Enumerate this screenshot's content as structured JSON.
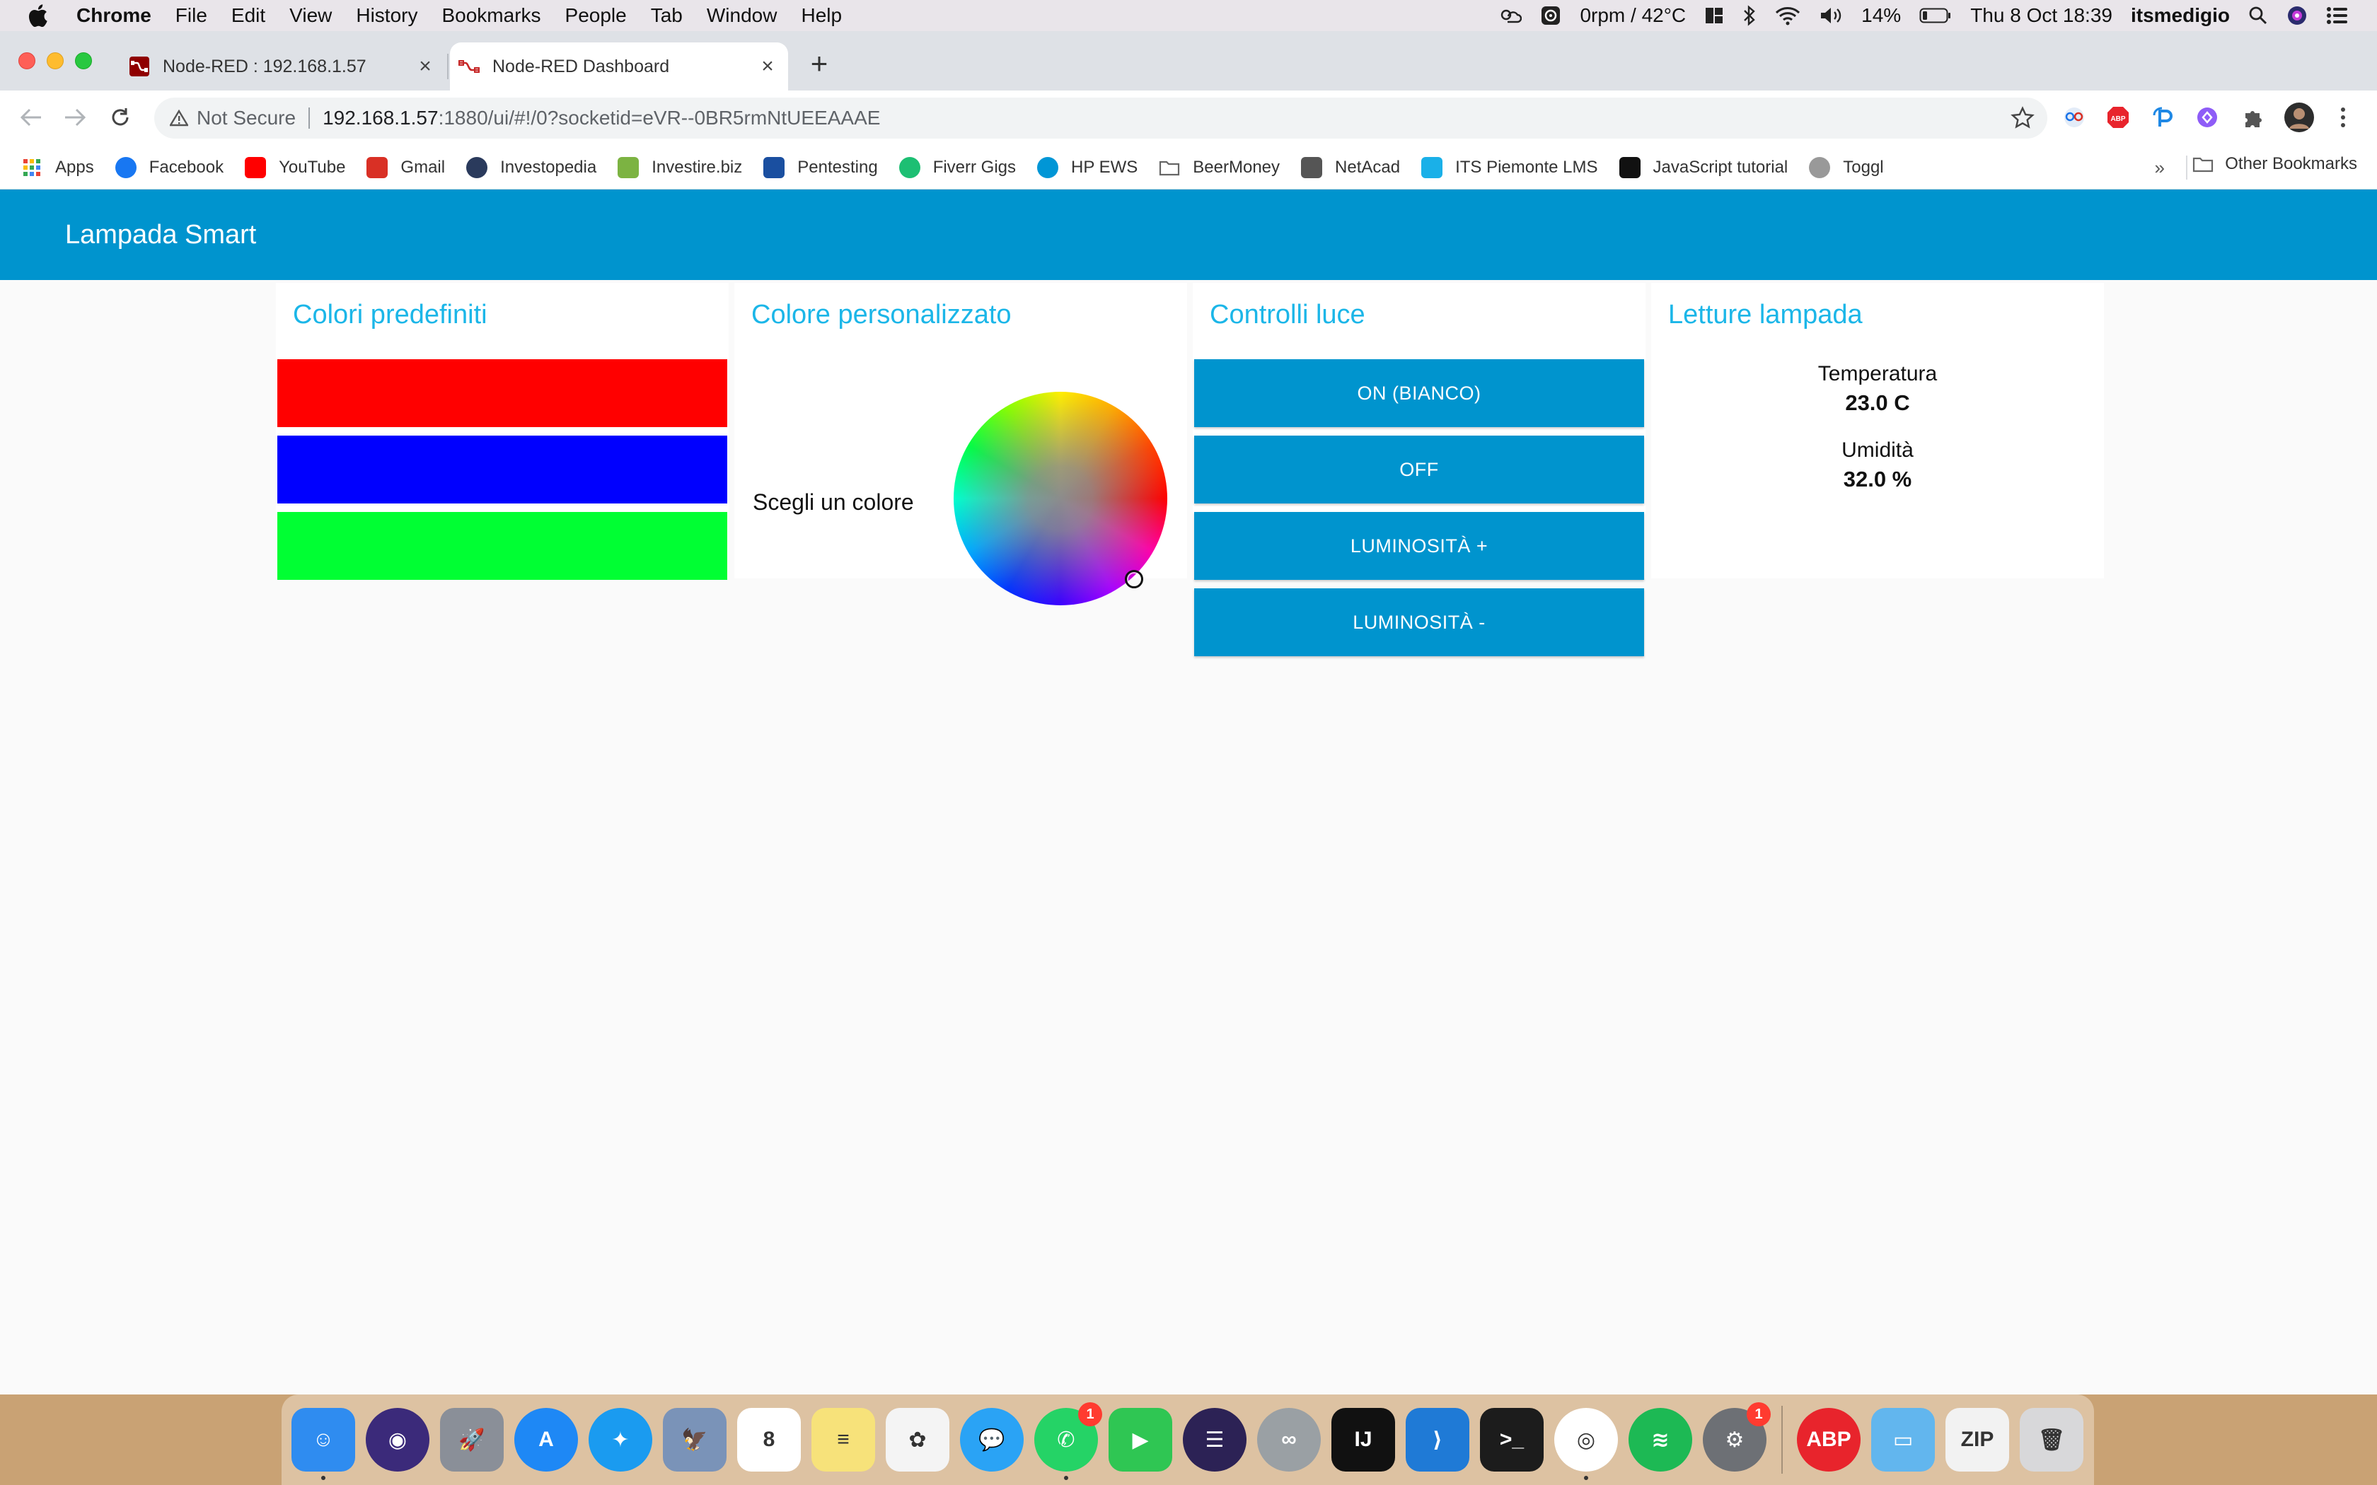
{
  "menubar": {
    "app": "Chrome",
    "items": [
      "File",
      "Edit",
      "View",
      "History",
      "Bookmarks",
      "People",
      "Tab",
      "Window",
      "Help"
    ],
    "fan_status": "0rpm / 42°C",
    "battery": "14%",
    "datetime": "Thu 8 Oct  18:39",
    "user": "itsmedigio"
  },
  "tabs": [
    {
      "title": "Node-RED : 192.168.1.57",
      "active": false
    },
    {
      "title": "Node-RED Dashboard",
      "active": true
    }
  ],
  "address": {
    "security": "Not Secure",
    "host": "192.168.1.57",
    "path": ":1880/ui/#!/0?socketid=eVR--0BR5rmNtUEEAAAE"
  },
  "bookmarks": [
    {
      "label": "Apps",
      "icon": "apps-grid-icon",
      "color": "#ea4335"
    },
    {
      "label": "Facebook",
      "icon": "facebook-icon",
      "color": "#1877f2"
    },
    {
      "label": "YouTube",
      "icon": "youtube-icon",
      "color": "#ff0000"
    },
    {
      "label": "Gmail",
      "icon": "gmail-icon",
      "color": "#d93025"
    },
    {
      "label": "Investopedia",
      "icon": "investopedia-icon",
      "color": "#2a3a5c"
    },
    {
      "label": "Investire.biz",
      "icon": "investire-icon",
      "color": "#7cb342"
    },
    {
      "label": "Pentesting",
      "icon": "shield-icon",
      "color": "#1a4fa0"
    },
    {
      "label": "Fiverr Gigs",
      "icon": "fiverr-icon",
      "color": "#1dbf73"
    },
    {
      "label": "HP EWS",
      "icon": "hp-icon",
      "color": "#0096d6"
    },
    {
      "label": "BeerMoney",
      "icon": "folder-icon",
      "color": "#888888"
    },
    {
      "label": "NetAcad",
      "icon": "cisco-icon",
      "color": "#555555"
    },
    {
      "label": "ITS Piemonte LMS",
      "icon": "bolt-icon",
      "color": "#1ab0e8"
    },
    {
      "label": "JavaScript tutorial",
      "icon": "js-icon",
      "color": "#111111"
    },
    {
      "label": "Toggl",
      "icon": "toggl-icon",
      "color": "#999999"
    }
  ],
  "other_bookmarks": "Other Bookmarks",
  "dashboard": {
    "title": "Lampada Smart",
    "groups": {
      "presets": {
        "title": "Colori predefiniti",
        "colors": [
          "#ff0000",
          "#0000ff",
          "#00ff33"
        ]
      },
      "custom": {
        "title": "Colore personalizzato",
        "label": "Scegli un colore"
      },
      "controls": {
        "title": "Controlli luce",
        "buttons": [
          "ON (BIANCO)",
          "OFF",
          "LUMINOSITÀ +",
          "LUMINOSITÀ -"
        ]
      },
      "readings": {
        "title": "Letture lampada",
        "temperature_label": "Temperatura",
        "temperature_value": "23.0 C",
        "humidity_label": "Umidità",
        "humidity_value": "32.0 %"
      }
    },
    "accent": "#0094ce",
    "group_title_color": "#1bb6e8"
  },
  "dock": {
    "apps": [
      {
        "name": "finder-icon",
        "color": "#2f8cf0",
        "glyph": "☺",
        "running": true
      },
      {
        "name": "siri-icon",
        "color": "#3b2a7a",
        "glyph": "◉"
      },
      {
        "name": "launchpad-icon",
        "color": "#8a8f98",
        "glyph": "🚀"
      },
      {
        "name": "app-store-icon",
        "color": "#1e88f5",
        "glyph": "A"
      },
      {
        "name": "safari-icon",
        "color": "#1a9bf0",
        "glyph": "✦"
      },
      {
        "name": "preview-icon",
        "color": "#7a93b8",
        "glyph": "🦅"
      },
      {
        "name": "calendar-icon",
        "color": "#ffffff",
        "glyph": "8"
      },
      {
        "name": "notes-icon",
        "color": "#f7e27a",
        "glyph": "≡"
      },
      {
        "name": "photos-icon",
        "color": "#f4f4f4",
        "glyph": "✿"
      },
      {
        "name": "messenger-icon",
        "color": "#2aa3f5",
        "glyph": "💬"
      },
      {
        "name": "whatsapp-icon",
        "color": "#25d366",
        "glyph": "✆",
        "badge": "1",
        "running": true
      },
      {
        "name": "facetime-icon",
        "color": "#2fc653",
        "glyph": "▶"
      },
      {
        "name": "eclipse-icon",
        "color": "#2c2255",
        "glyph": "☰"
      },
      {
        "name": "arduino-icon",
        "color": "#9aa0a4",
        "glyph": "∞"
      },
      {
        "name": "intellij-icon",
        "color": "#111111",
        "glyph": "IJ"
      },
      {
        "name": "vscode-icon",
        "color": "#1f7ad6",
        "glyph": "⟩"
      },
      {
        "name": "terminal-icon",
        "color": "#1c1c1c",
        "glyph": ">_"
      },
      {
        "name": "chrome-icon",
        "color": "#ffffff",
        "glyph": "◎",
        "running": true
      },
      {
        "name": "spotify-icon",
        "color": "#1db954",
        "glyph": "≋"
      },
      {
        "name": "system-preferences-icon",
        "color": "#6d7075",
        "glyph": "⚙",
        "badge": "1"
      },
      {
        "name": "adblock-icon",
        "color": "#e8242c",
        "glyph": "ABP"
      },
      {
        "name": "files-folder-icon",
        "color": "#62b6ee",
        "glyph": "▭"
      },
      {
        "name": "zip-archive-icon",
        "color": "#f2f2f2",
        "glyph": "ZIP"
      },
      {
        "name": "trash-icon",
        "color": "#d8d8da",
        "glyph": "🗑"
      }
    ]
  }
}
